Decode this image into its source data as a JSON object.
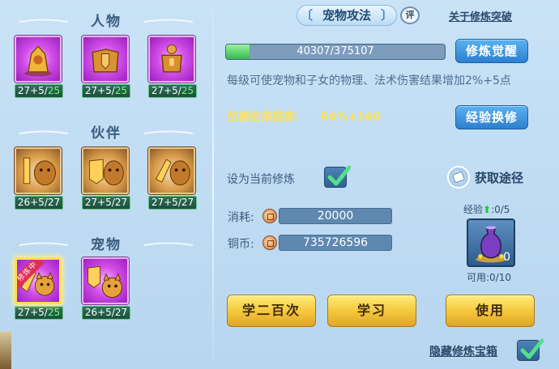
{
  "left": {
    "sections": [
      {
        "title": "人物",
        "cards": [
          {
            "icon": "character-crest-icon",
            "lvl_main": "27+5/",
            "lvl_hl": "25"
          },
          {
            "icon": "character-shield-armor-icon",
            "lvl_main": "27+5/",
            "lvl_hl": "25"
          },
          {
            "icon": "character-armor-icon",
            "lvl_main": "27+5/",
            "lvl_hl": "25"
          }
        ]
      },
      {
        "title": "伙伴",
        "cards": [
          {
            "icon": "partner-sword-beast-icon",
            "lvl_main": "26+5/27",
            "lvl_hl": ""
          },
          {
            "icon": "partner-shield-beast-icon",
            "lvl_main": "27+5/27",
            "lvl_hl": ""
          },
          {
            "icon": "partner-claw-beast-icon",
            "lvl_main": "27+5/27",
            "lvl_hl": ""
          }
        ]
      },
      {
        "title": "宠物",
        "cards": [
          {
            "icon": "pet-attack-cat-icon",
            "lvl_main": "27+5/",
            "lvl_hl": "25",
            "ribbon": "修炼中"
          },
          {
            "icon": "pet-defense-cat-icon",
            "lvl_main": "26+5/27",
            "lvl_hl": ""
          }
        ]
      }
    ]
  },
  "right": {
    "title": "宠物攻法",
    "rate_badge": "评",
    "breakthrough_link": "关于修炼突破",
    "progress": {
      "text": "40307/375107",
      "fraction": 0.107
    },
    "awaken_button": "修炼觉醒",
    "description": "每级可使宠物和子女的物理、法术伤害结果增加2%+5点",
    "effect_label": "伤害结果提高:",
    "effect_value": "64%+160",
    "exchange_button": "经验换修",
    "set_current_label": "设为当前修炼",
    "get_path_label": "获取途径",
    "cost_label": "消耗:",
    "cost_value": "20000",
    "copper_label": "铜币:",
    "copper_value": "735726596",
    "exp_label": "经验",
    "exp_value": ":0/5",
    "chest_count": "0",
    "usable": "可用:0/10",
    "btn_learn200": "学二百次",
    "btn_learn": "学习",
    "btn_use": "使用",
    "hide_chest_label": "隐藏修炼宝箱"
  },
  "colors": {
    "accent_gold": "#ffe25a",
    "progress_green": "#36b652",
    "level_green": "#6cff6c",
    "button_blue": "#2d7fcf",
    "button_gold": "#f3c53a"
  }
}
